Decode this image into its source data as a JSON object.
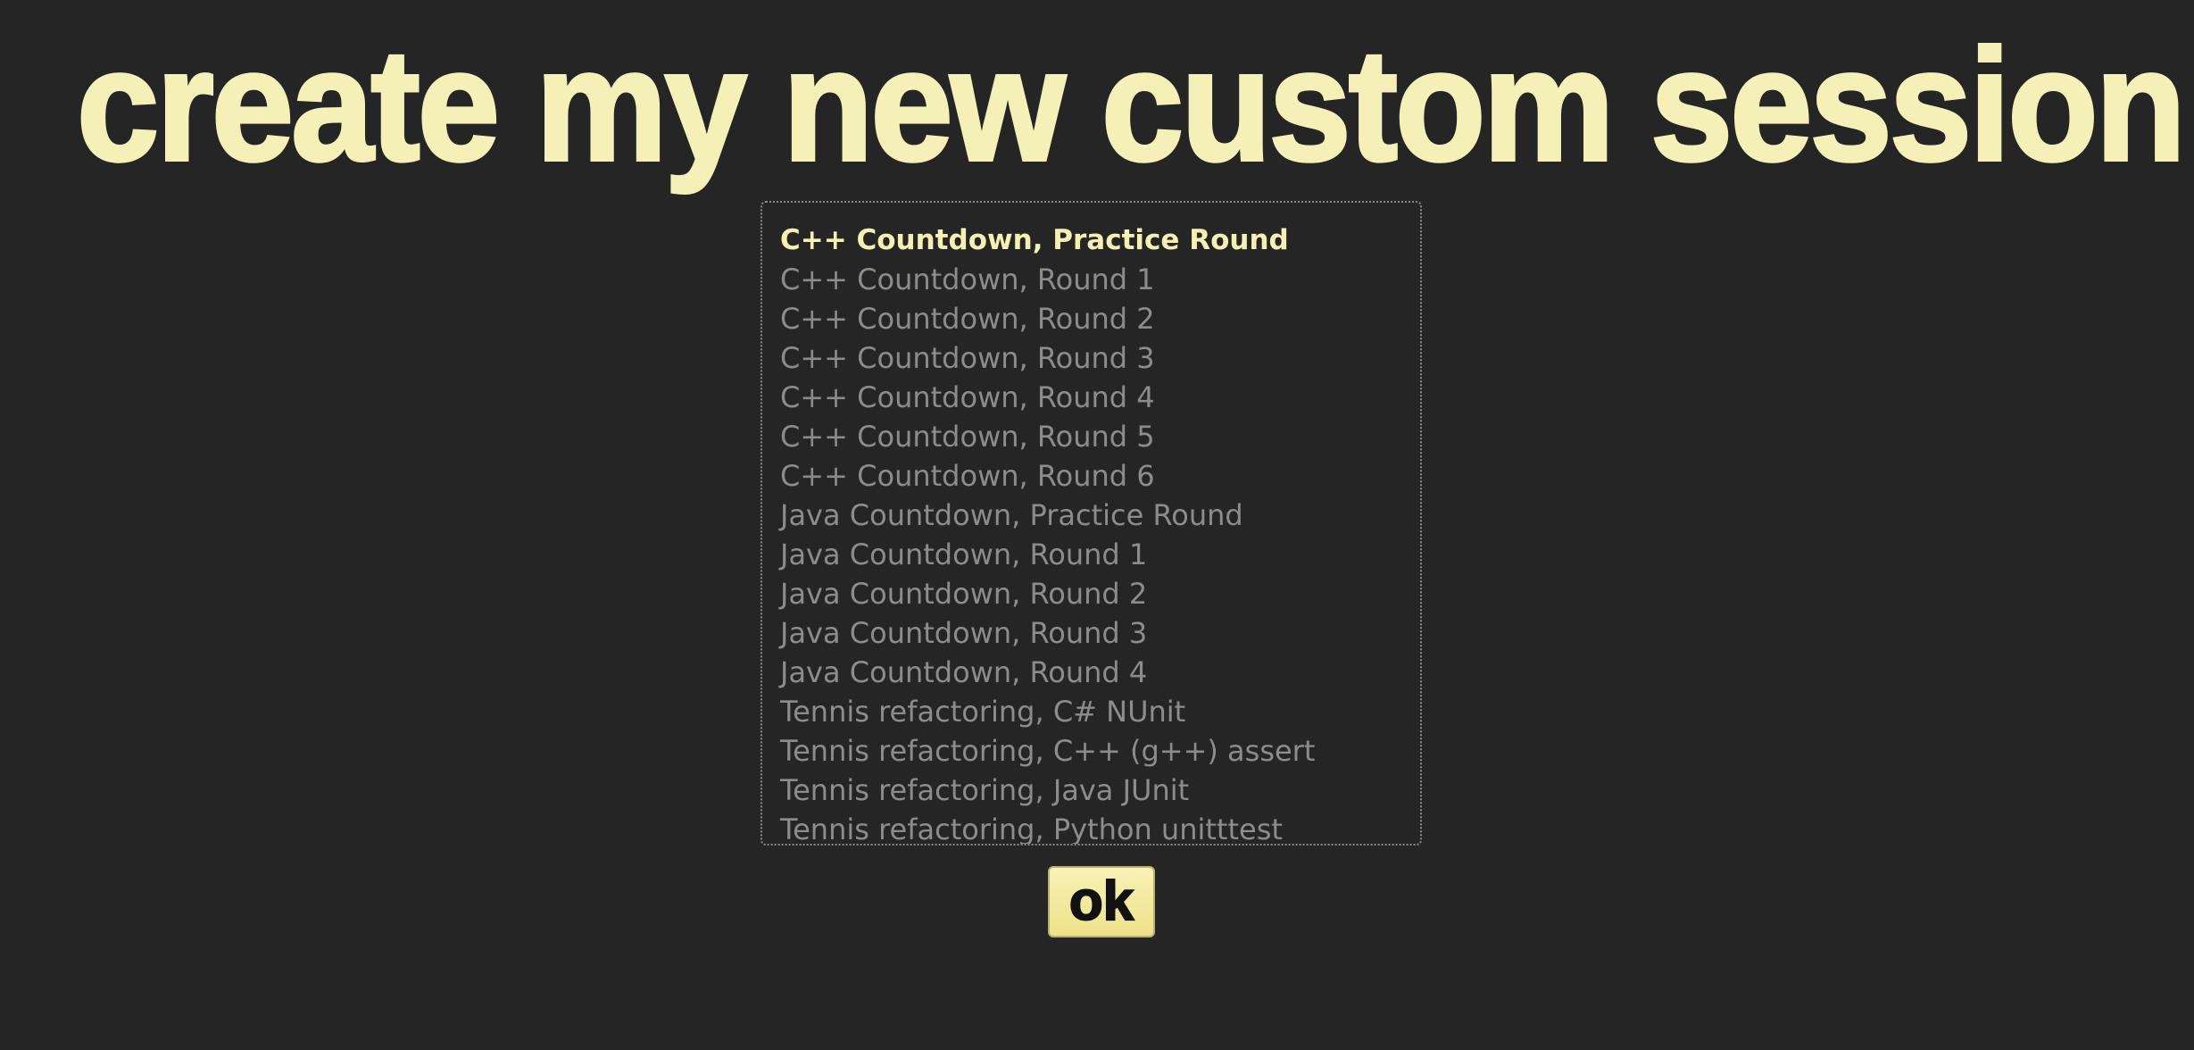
{
  "title": "create my new custom session",
  "exercises": {
    "selected_index": 0,
    "options": [
      "C++ Countdown, Practice Round",
      "C++ Countdown, Round 1",
      "C++ Countdown, Round 2",
      "C++ Countdown, Round 3",
      "C++ Countdown, Round 4",
      "C++ Countdown, Round 5",
      "C++ Countdown, Round 6",
      "Java Countdown, Practice Round",
      "Java Countdown, Round 1",
      "Java Countdown, Round 2",
      "Java Countdown, Round 3",
      "Java Countdown, Round 4",
      "Tennis refactoring, C# NUnit",
      "Tennis refactoring, C++ (g++) assert",
      "Tennis refactoring, Java JUnit",
      "Tennis refactoring, Python unitttest"
    ]
  },
  "ok_button": {
    "label": "ok"
  },
  "colors": {
    "background": "#252525",
    "accent": "#f5f0b8",
    "option_text": "#8c8c8c",
    "selected_text": "#f7efb4"
  }
}
